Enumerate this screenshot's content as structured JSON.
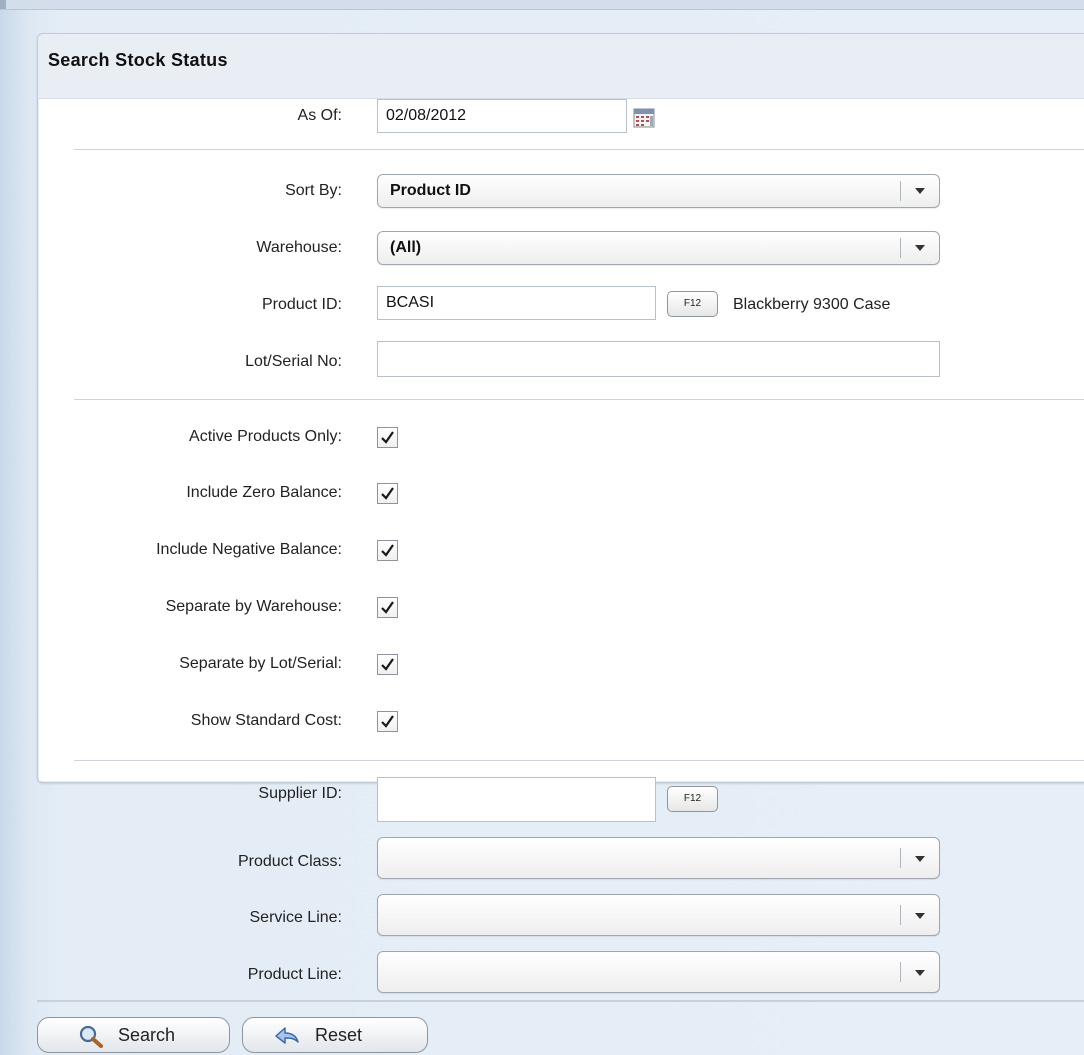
{
  "panel": {
    "title": "Search Stock Status"
  },
  "form": {
    "as_of": {
      "label": "As Of:",
      "value": "02/08/2012",
      "icon": "calendar-icon"
    },
    "sort_by": {
      "label": "Sort By:",
      "value": "Product ID"
    },
    "warehouse": {
      "label": "Warehouse:",
      "value": "(All)"
    },
    "product_id": {
      "label": "Product ID:",
      "value": "BCASI",
      "lookup_label": "F12",
      "description": "Blackberry 9300 Case"
    },
    "lot_serial": {
      "label": "Lot/Serial No:",
      "value": ""
    },
    "checkboxes": [
      {
        "label": "Active Products Only:",
        "checked": true
      },
      {
        "label": "Include Zero Balance:",
        "checked": true
      },
      {
        "label": "Include Negative Balance:",
        "checked": true
      },
      {
        "label": "Separate by Warehouse:",
        "checked": true
      },
      {
        "label": "Separate by Lot/Serial:",
        "checked": true
      },
      {
        "label": "Show Standard Cost:",
        "checked": true
      }
    ],
    "supplier_id": {
      "label": "Supplier ID:",
      "value": "",
      "lookup_label": "F12"
    },
    "product_class": {
      "label": "Product Class:",
      "value": ""
    },
    "service_line": {
      "label": "Service Line:",
      "value": ""
    },
    "product_line": {
      "label": "Product Line:",
      "value": ""
    }
  },
  "buttons": {
    "search": {
      "label": "Search",
      "icon": "magnifier-icon"
    },
    "reset": {
      "label": "Reset",
      "icon": "undo-arrow-icon"
    }
  }
}
